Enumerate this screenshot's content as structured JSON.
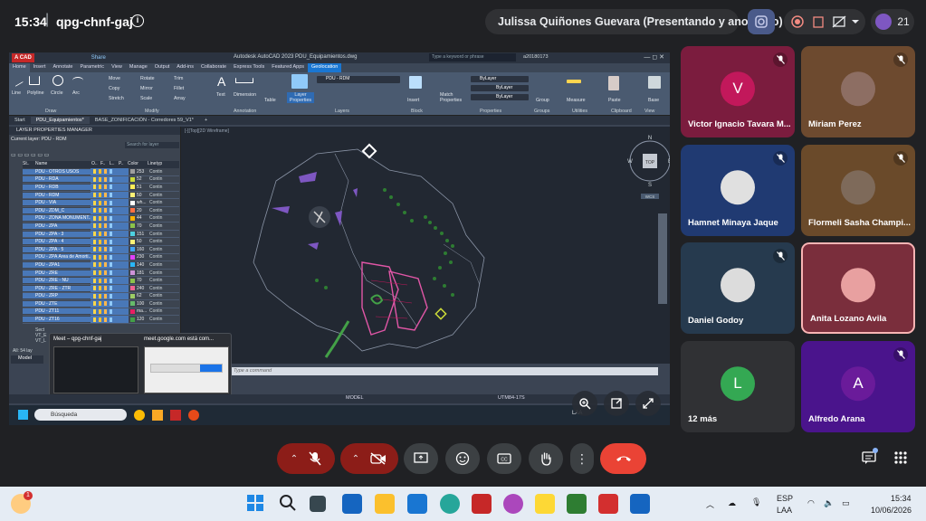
{
  "meet": {
    "time": "15:34",
    "separator": "|",
    "code": "qpg-chnf-gaj",
    "presenter": "Julissa Quiñones Guevara (Presentando y anotando)",
    "participant_count": "21"
  },
  "autocad": {
    "title": "Autodesk AutoCAD 2023    PDU_Equipamientos.dwg",
    "share": "Share",
    "search_placeholder": "Type a keyword or phrase",
    "user": "a20180173",
    "tabs": [
      "Home",
      "Insert",
      "Annotate",
      "Parametric",
      "View",
      "Manage",
      "Output",
      "Add-ins",
      "Collaborate",
      "Express Tools",
      "Featured Apps",
      "Geolocation"
    ],
    "ribbon_buttons": [
      "Line",
      "Polyline",
      "Circle",
      "Arc",
      "Move",
      "Copy",
      "Stretch",
      "Rotate",
      "Mirror",
      "Scale",
      "Trim",
      "Fillet",
      "Array",
      "Text",
      "Dimension",
      "Table",
      "Layer Properties",
      "Insert",
      "Match Properties",
      "Group",
      "Measure",
      "Paste",
      "Base"
    ],
    "ribbon_groups": [
      "Draw",
      "Modify",
      "Annotation",
      "Layers",
      "Block",
      "Properties",
      "Groups",
      "Utilities",
      "Clipboard",
      "View"
    ],
    "layer_combo": "PDU - RDM",
    "bylayer": "ByLayer",
    "doc_tabs": [
      "Start",
      "PDU_Equipamientos*",
      "BASE_ZONIFICACIÓN - Corredores 59_V1*"
    ],
    "layer_panel_title": "LAYER PROPERTIES MANAGER",
    "current_layer": "Current layer: PDU - RDM",
    "search_layer": "Search for layer",
    "layer_columns": [
      "St..",
      "Name",
      "O..",
      "F..",
      "L..",
      "P..",
      "Color",
      "Linetyp"
    ],
    "layers": [
      {
        "name": "PDU - OTROS USOS",
        "color": "253",
        "swatch": "#9e9e9e",
        "lt": "Contin"
      },
      {
        "name": "PDU - RDA",
        "color": "52",
        "swatch": "#cddc39",
        "lt": "Contin"
      },
      {
        "name": "PDU - RDB",
        "color": "51",
        "swatch": "#ffee58",
        "lt": "Contin"
      },
      {
        "name": "PDU - RDM",
        "color": "50",
        "swatch": "#fff176",
        "lt": "Contin"
      },
      {
        "name": "PDU - VIA",
        "color": "wh...",
        "swatch": "#ffffff",
        "lt": "Contin"
      },
      {
        "name": "PDU - ZDM_C",
        "color": "20",
        "swatch": "#ff7043",
        "lt": "Contin"
      },
      {
        "name": "PDU - ZONA MONUMENT...",
        "color": "44",
        "swatch": "#ffb300",
        "lt": "Contin"
      },
      {
        "name": "PDU - ZPA",
        "color": "70",
        "swatch": "#8bc34a",
        "lt": "Contin"
      },
      {
        "name": "PDU - ZPA - 3",
        "color": "151",
        "swatch": "#4dd0e1",
        "lt": "Contin"
      },
      {
        "name": "PDU - ZPA - 4",
        "color": "50",
        "swatch": "#fff176",
        "lt": "Contin"
      },
      {
        "name": "PDU - ZPA - 5",
        "color": "160",
        "swatch": "#42a5f5",
        "lt": "Contin"
      },
      {
        "name": "PDU - ZPA Área de Amorti...",
        "color": "230",
        "swatch": "#e040fb",
        "lt": "Contin"
      },
      {
        "name": "PDU - ZPA1",
        "color": "140",
        "swatch": "#29b6f6",
        "lt": "Contin"
      },
      {
        "name": "PDU - ZRE",
        "color": "181",
        "swatch": "#ce93d8",
        "lt": "Contin"
      },
      {
        "name": "PDU - ZRE - NU",
        "color": "70",
        "swatch": "#8bc34a",
        "lt": "Contin"
      },
      {
        "name": "PDU - ZRE - ZTR",
        "color": "240",
        "swatch": "#f06292",
        "lt": "Contin"
      },
      {
        "name": "PDU - ZRP",
        "color": "62",
        "swatch": "#9ccc65",
        "lt": "Contin"
      },
      {
        "name": "PDU - ZTE",
        "color": "100",
        "swatch": "#66bb6a",
        "lt": "Contin"
      },
      {
        "name": "PDU - ZT11",
        "color": "ma...",
        "swatch": "#e91e63",
        "lt": "Contin"
      },
      {
        "name": "PDU - ZT16",
        "color": "120",
        "swatch": "#43a047",
        "lt": "Contin"
      }
    ],
    "canvas_label": "[-][Top][2D Wireframe]",
    "viewcube_top": "TOP",
    "compass": {
      "n": "N",
      "s": "S",
      "e": "E",
      "w": "W"
    },
    "wcs": "WCS",
    "command_placeholder": "Type a command",
    "panel_footer": "All: 54 lay",
    "model_tab": "Model",
    "status_model": "MODEL",
    "status_coords": "UTM84-17S",
    "taskbar_search": "Búsqueda",
    "lang": "LAA",
    "popup_left": "Meet – qpg-chnf-gaj",
    "popup_right": "meet.google.com está com..."
  },
  "participants": [
    {
      "name": "Victor Ignacio Tavara M...",
      "initial": "V",
      "bg": "#7b1c3e",
      "av": "#c2185b",
      "muted": true
    },
    {
      "name": "Miriam Perez",
      "initial": "",
      "bg": "#6d4a2f",
      "av": "#8d6e63",
      "muted": true
    },
    {
      "name": "Hamnet Minaya Jaque",
      "initial": "",
      "bg": "#203a72",
      "av": "#e0e0e0",
      "muted": true
    },
    {
      "name": "Flormeli Sasha Champi...",
      "initial": "",
      "bg": "#6a4a2a",
      "av": "#7e6a5a",
      "muted": true
    },
    {
      "name": "Daniel Godoy",
      "initial": "",
      "bg": "#263a4e",
      "av": "#dcdcdc",
      "muted": true
    },
    {
      "name": "Anita Lozano Avila",
      "initial": "",
      "bg": "#7a2e3c",
      "av": "#e8a0a0",
      "muted": false
    },
    {
      "name": "12 más",
      "initial": "L",
      "bg": "#303134",
      "av": "#34a853",
      "muted": false
    },
    {
      "name": "Alfredo Arana",
      "initial": "A",
      "bg": "#4a148c",
      "av": "#6a1b9a",
      "muted": true
    }
  ],
  "windows": {
    "time": "15:34",
    "date": "10/06/2026",
    "lang1": "ESP",
    "lang2": "LAA",
    "notification": "1"
  }
}
